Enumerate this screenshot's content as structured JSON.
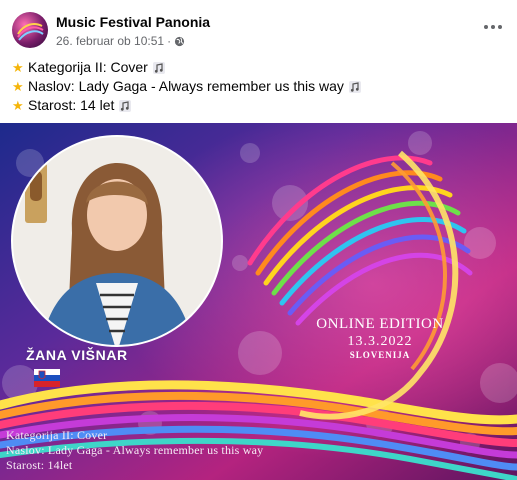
{
  "post": {
    "page_name": "Music Festival Panonia",
    "timestamp": "26. februar ob 10:51",
    "separator": "·",
    "lines": [
      {
        "label": "Kategorija II: Cover"
      },
      {
        "label": "Naslov: Lady Gaga - Always remember us this way"
      },
      {
        "label": "Starost: 14 let"
      }
    ]
  },
  "image": {
    "performer_name": "ŽANA VIŠNAR",
    "edition": "ONLINE EDITION",
    "date": "13.3.2022",
    "country": "SLOVENIJA",
    "caption_lines": [
      "Kategorija II: Cover",
      "Naslov: Lady Gaga - Always remember us this way",
      "Starost: 14let"
    ]
  },
  "icons": {
    "star": "star-icon",
    "note": "music-note-icon",
    "globe": "globe-icon",
    "more": "more-options-icon"
  },
  "colors": {
    "star": "#f5b50a",
    "meta_text": "#65676b",
    "bg_purple": "#4a1f6b",
    "bg_magenta": "#c2267a"
  }
}
